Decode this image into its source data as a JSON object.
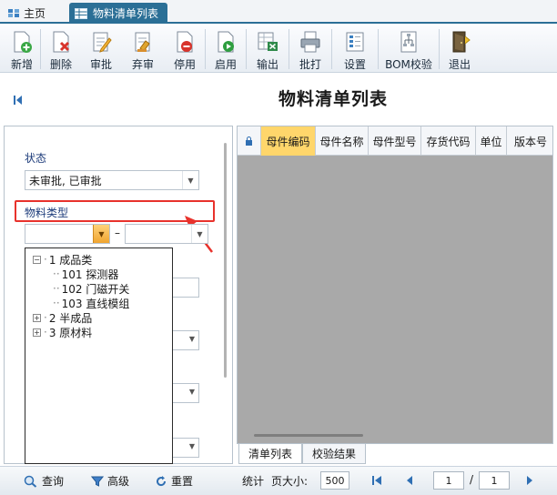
{
  "tabs": {
    "home_label": "主页",
    "active_label": "物料清单列表"
  },
  "toolbar": {
    "buttons": [
      {
        "label": "新增",
        "icon": "add-doc-icon"
      },
      {
        "label": "删除",
        "icon": "delete-doc-icon"
      },
      {
        "label": "审批",
        "icon": "approve-icon"
      },
      {
        "label": "弃审",
        "icon": "unapprove-icon"
      },
      {
        "label": "停用",
        "icon": "disable-icon"
      },
      {
        "label": "启用",
        "icon": "enable-icon"
      },
      {
        "label": "输出",
        "icon": "export-icon"
      },
      {
        "label": "批打",
        "icon": "print-icon"
      },
      {
        "label": "设置",
        "icon": "settings-icon"
      },
      {
        "label": "BOM校验",
        "icon": "bom-check-icon"
      },
      {
        "label": "退出",
        "icon": "exit-icon"
      }
    ]
  },
  "page": {
    "title": "物料清单列表"
  },
  "filter": {
    "status_label": "状态",
    "status_value": "未审批, 已审批",
    "material_type_label": "物料类型",
    "range_separator": "–",
    "tree": [
      {
        "label": "1 成品类",
        "level": 0,
        "expander": "−"
      },
      {
        "label": "101 探测器",
        "level": 1
      },
      {
        "label": "102 门磁开关",
        "level": 1
      },
      {
        "label": "103 直线模组",
        "level": 1
      },
      {
        "label": "2 半成品",
        "level": 0,
        "expander": "+"
      },
      {
        "label": "3 原材料",
        "level": 0,
        "expander": "+"
      }
    ]
  },
  "grid": {
    "columns": [
      "母件编码",
      "母件名称",
      "母件型号",
      "存货代码",
      "单位",
      "版本号"
    ],
    "active_column": "母件编码"
  },
  "subtabs": [
    "清单列表",
    "校验结果"
  ],
  "bottom": {
    "query_label": "查询",
    "advanced_label": "高级",
    "reset_label": "重置",
    "stats_label": "统计",
    "page_size_label": "页大小:",
    "page_size": "500",
    "current_page": "1",
    "page_separator": "/",
    "total_pages": "1"
  },
  "colors": {
    "accent": "#2b6f96",
    "highlight_border": "#e8322c",
    "active_column": "#ffd66b"
  }
}
